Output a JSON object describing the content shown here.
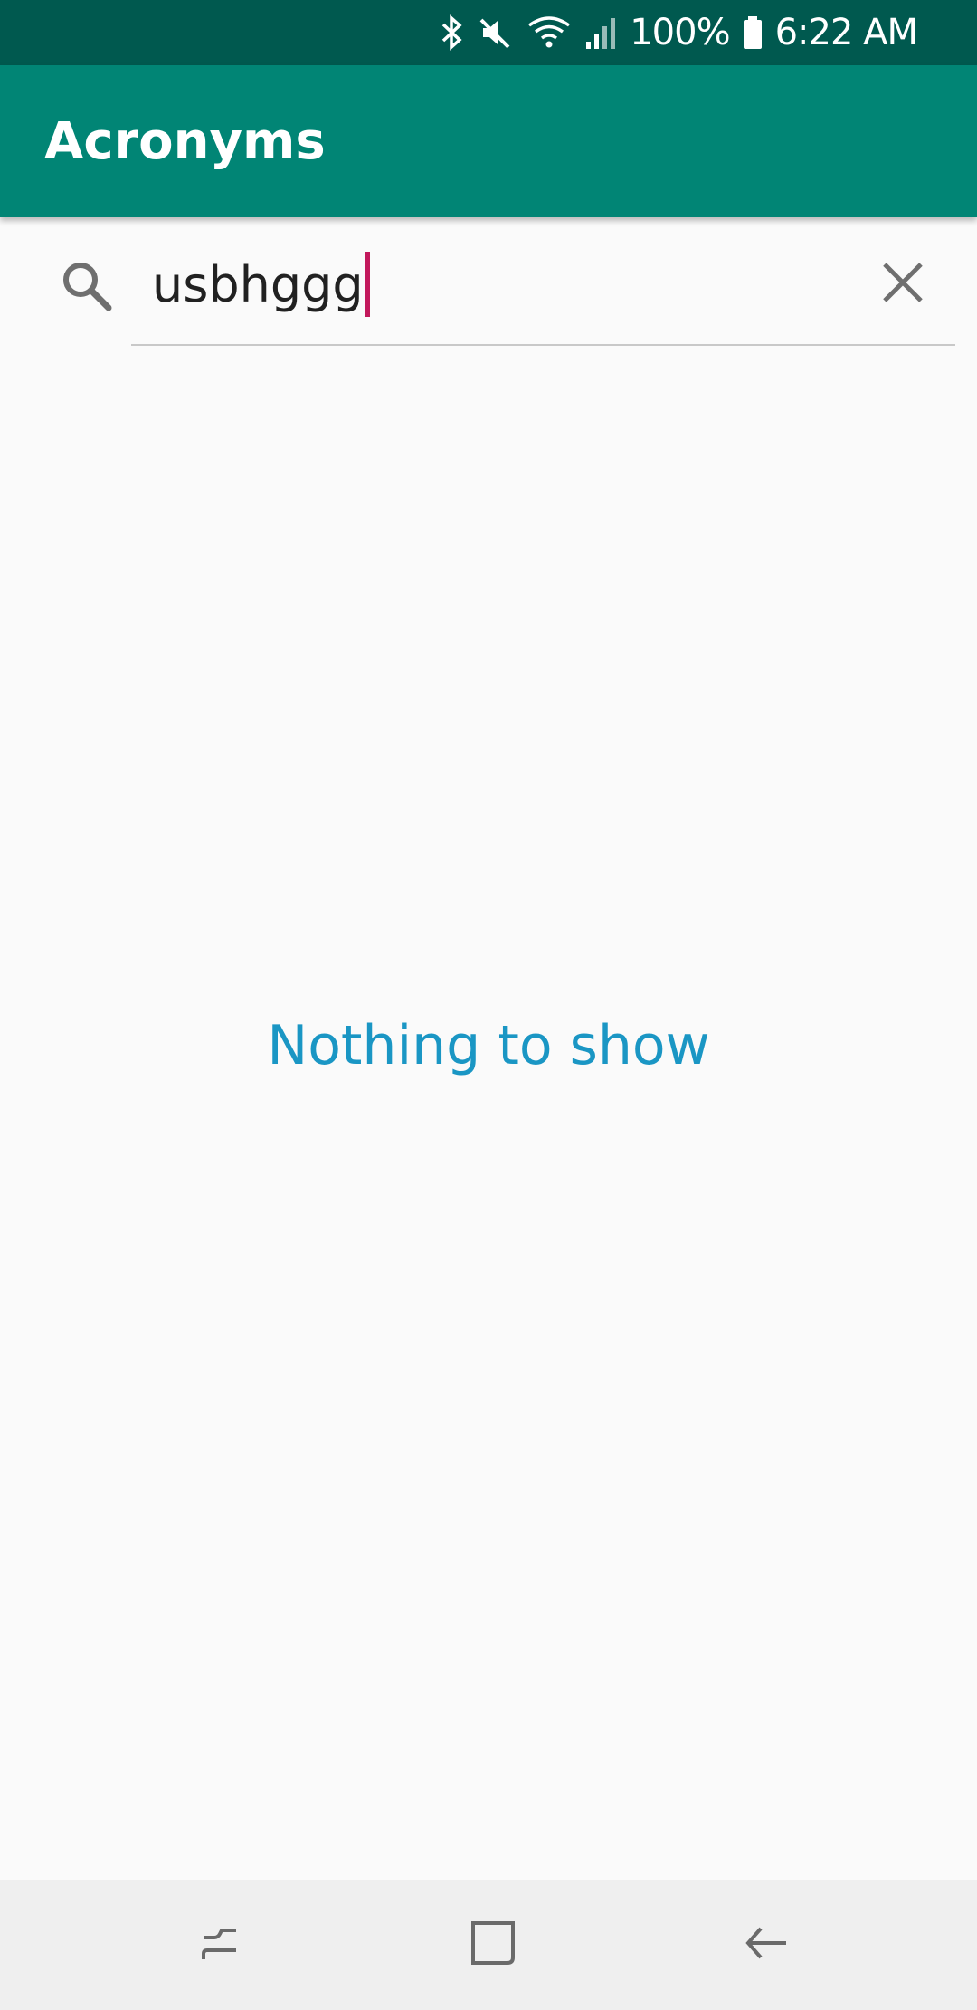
{
  "status_bar": {
    "battery": "100%",
    "time": "6:22 AM",
    "icons": [
      "bluetooth-icon",
      "mute-icon",
      "wifi-icon",
      "signal-icon",
      "battery-icon"
    ]
  },
  "app_bar": {
    "title": "Acronyms",
    "color": "#018575"
  },
  "search": {
    "value": "usbhggg",
    "icon": "search-icon",
    "clear_icon": "close-icon"
  },
  "main": {
    "empty_message": "Nothing to show",
    "empty_message_color": "#1a96c4"
  },
  "nav_bar": {
    "buttons": [
      "recents-icon",
      "home-icon",
      "back-icon"
    ]
  }
}
